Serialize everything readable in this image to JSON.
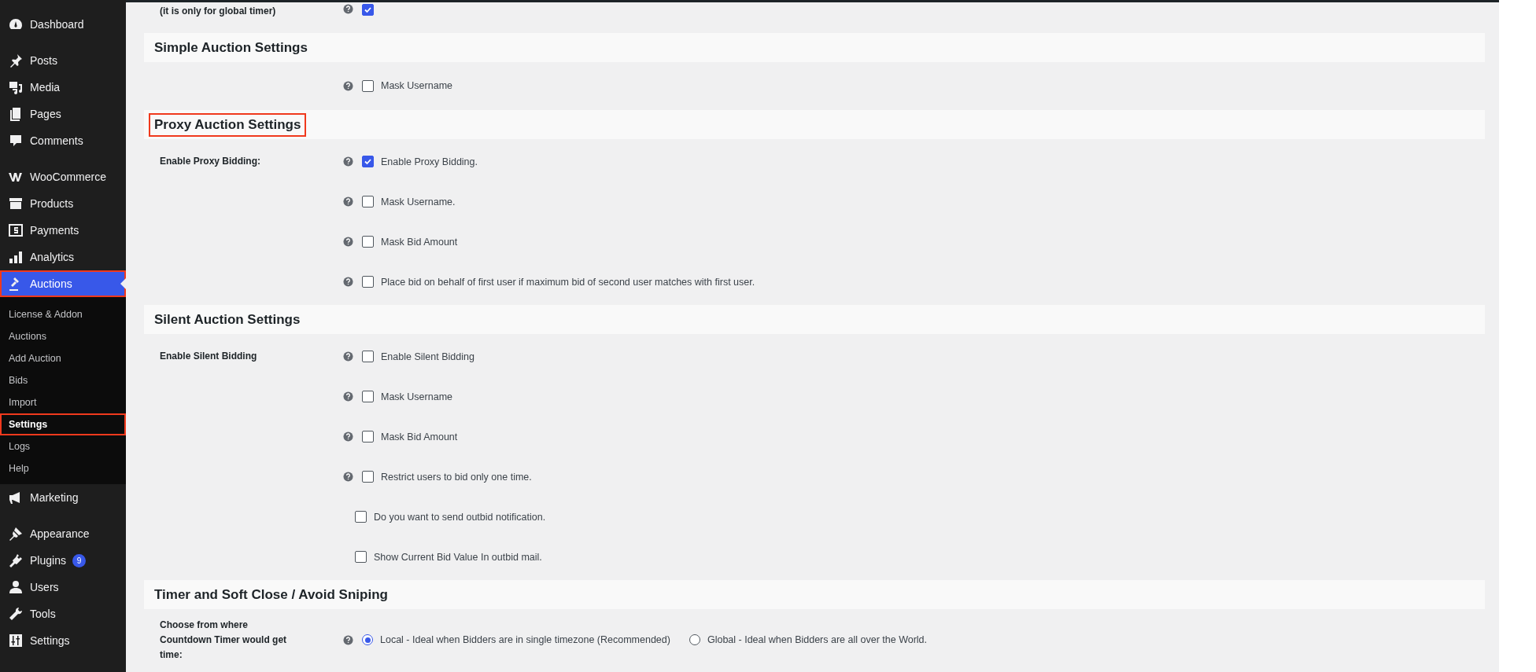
{
  "sidebar": {
    "groups": [
      {
        "items": [
          {
            "label": "Dashboard",
            "selected": false,
            "highlighted": false
          }
        ]
      },
      {
        "items": [
          {
            "label": "Posts",
            "selected": false,
            "highlighted": false
          },
          {
            "label": "Media",
            "selected": false,
            "highlighted": false
          },
          {
            "label": "Pages",
            "selected": false,
            "highlighted": false
          },
          {
            "label": "Comments",
            "selected": false,
            "highlighted": false
          }
        ]
      },
      {
        "items": [
          {
            "label": "WooCommerce",
            "selected": false,
            "highlighted": false
          },
          {
            "label": "Products",
            "selected": false,
            "highlighted": false
          },
          {
            "label": "Payments",
            "selected": false,
            "highlighted": false
          },
          {
            "label": "Analytics",
            "selected": false,
            "highlighted": false
          },
          {
            "label": "Auctions",
            "selected": true,
            "highlighted": true,
            "children": [
              {
                "label": "License & Addon",
                "selected": false,
                "highlighted": false
              },
              {
                "label": "Auctions",
                "selected": false,
                "highlighted": false
              },
              {
                "label": "Add Auction",
                "selected": false,
                "highlighted": false
              },
              {
                "label": "Bids",
                "selected": false,
                "highlighted": false
              },
              {
                "label": "Import",
                "selected": false,
                "highlighted": false
              },
              {
                "label": "Settings",
                "selected": true,
                "highlighted": true
              },
              {
                "label": "Logs",
                "selected": false,
                "highlighted": false
              },
              {
                "label": "Help",
                "selected": false,
                "highlighted": false
              }
            ]
          },
          {
            "label": "Marketing",
            "selected": false,
            "highlighted": false
          }
        ]
      },
      {
        "items": [
          {
            "label": "Appearance",
            "selected": false,
            "highlighted": false
          },
          {
            "label": "Plugins",
            "selected": false,
            "highlighted": false,
            "badge": "9"
          },
          {
            "label": "Users",
            "selected": false,
            "highlighted": false
          },
          {
            "label": "Tools",
            "selected": false,
            "highlighted": false
          },
          {
            "label": "Settings",
            "selected": false,
            "highlighted": false
          }
        ]
      }
    ]
  },
  "sections": [
    {
      "rows": [
        {
          "label": "(it is only for global timer)",
          "help": true,
          "kind": "checkbox",
          "checked": true
        }
      ]
    },
    {
      "title": "Simple Auction Settings",
      "highlighted": false,
      "rows": [
        {
          "help": true,
          "kind": "checkbox",
          "checked": false,
          "text": "Mask Username"
        }
      ]
    },
    {
      "title": "Proxy Auction Settings",
      "highlighted": true,
      "rows": [
        {
          "label": "Enable Proxy Bidding:",
          "help": true,
          "kind": "checkbox",
          "checked": true,
          "text": "Enable Proxy Bidding."
        },
        {
          "help": true,
          "kind": "checkbox",
          "checked": false,
          "text": "Mask Username."
        },
        {
          "help": true,
          "kind": "checkbox",
          "checked": false,
          "text": "Mask Bid Amount"
        },
        {
          "help": true,
          "kind": "checkbox",
          "checked": false,
          "text": "Place bid on behalf of first user if maximum bid of second user matches with first user."
        }
      ]
    },
    {
      "title": "Silent Auction Settings",
      "highlighted": false,
      "rows": [
        {
          "label": "Enable Silent Bidding",
          "help": true,
          "kind": "checkbox",
          "checked": false,
          "text": "Enable Silent Bidding"
        },
        {
          "help": true,
          "kind": "checkbox",
          "checked": false,
          "text": "Mask Username"
        },
        {
          "help": true,
          "kind": "checkbox",
          "checked": false,
          "text": "Mask Bid Amount"
        },
        {
          "help": true,
          "kind": "checkbox",
          "checked": false,
          "text": "Restrict users to bid only one time."
        },
        {
          "help": false,
          "kind": "checkbox",
          "checked": false,
          "text": "Do you want to send outbid notification."
        },
        {
          "help": false,
          "kind": "checkbox",
          "checked": false,
          "text": "Show Current Bid Value In outbid mail."
        }
      ]
    },
    {
      "title": "Timer and Soft Close / Avoid Sniping",
      "highlighted": false,
      "rows": [
        {
          "label": "Choose from where Countdown Timer would get time:",
          "help": true,
          "kind": "radio",
          "options": [
            {
              "text": "Local - Ideal when Bidders are in single timezone (Recommended)",
              "selected": true
            },
            {
              "text": "Global - Ideal when Bidders are all over the World.",
              "selected": false
            }
          ]
        }
      ]
    }
  ]
}
